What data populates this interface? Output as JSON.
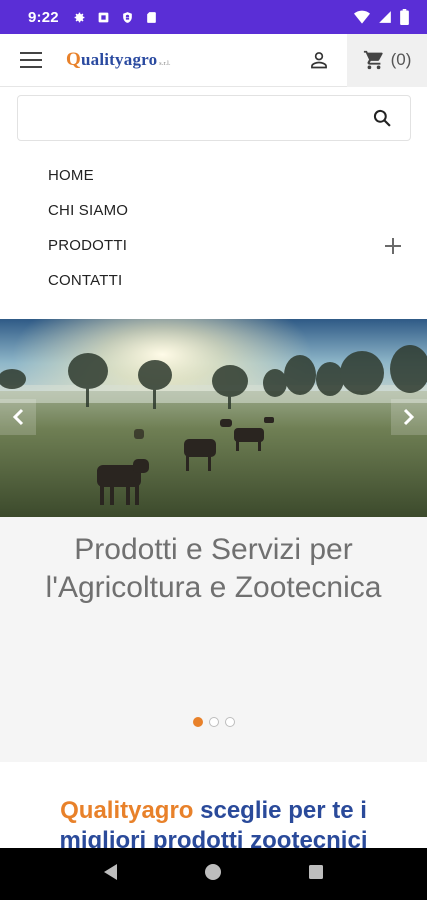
{
  "status_bar": {
    "time": "9:22",
    "background": "#5a2ed6"
  },
  "header": {
    "logo_first_letter": "Q",
    "logo_rest": "ualityagro",
    "logo_suffix": "s.r.l.",
    "cart_count": "(0)"
  },
  "search": {
    "value": "",
    "placeholder": ""
  },
  "nav": {
    "items": [
      {
        "label": "HOME"
      },
      {
        "label": "CHI SIAMO"
      },
      {
        "label": "PRODOTTI",
        "expandable": true
      },
      {
        "label": "CONTATTI"
      }
    ]
  },
  "slider": {
    "caption_line1": "Prodotti e Servizi per",
    "caption_line2": "l'Agricoltura e Zootecnica",
    "slide_count": 3,
    "active_slide": 1
  },
  "section": {
    "brand_word": "Qualityagro",
    "heading_rest_line1": " sceglie per te i",
    "heading_line2": "migliori prodotti zootecnici"
  },
  "colors": {
    "accent_orange": "#e8812a",
    "brand_blue": "#2a4a9a",
    "caption_gray": "#707070"
  },
  "icons": {
    "menu": "hamburger-icon",
    "user": "user-icon",
    "cart": "cart-icon",
    "search": "search-icon",
    "expand": "plus-icon",
    "prev": "chevron-left-icon",
    "next": "chevron-right-icon"
  }
}
